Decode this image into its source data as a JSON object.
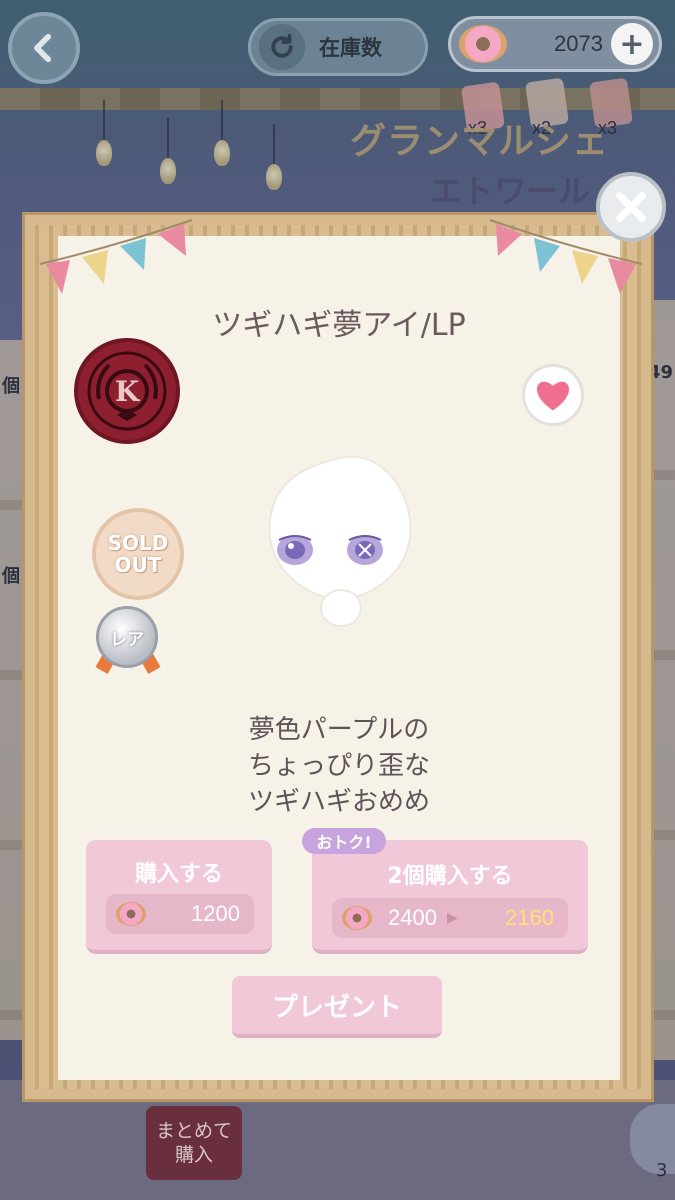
{
  "topbar": {
    "stock_label": "在庫数",
    "currency_value": "2073",
    "plus_label": "+"
  },
  "tickets": [
    {
      "count": "x3"
    },
    {
      "count": "x2"
    },
    {
      "count": "x3"
    }
  ],
  "event": {
    "title": "グランマルシェ",
    "subtitle": "エトワール"
  },
  "side_labels": {
    "left_count_1": "個",
    "left_count_2": "個",
    "right_count": "49",
    "corner_count": "3"
  },
  "item": {
    "title": "ツギハギ夢アイ/LP",
    "brand_letter": "K",
    "sold_out_line1": "SOLD",
    "sold_out_line2": "OUT",
    "rarity": "レア",
    "description_line1": "夢色パープルの",
    "description_line2": "ちょっぴり歪な",
    "description_line3": "ツギハギおめめ"
  },
  "buy_single": {
    "label": "購入する",
    "price": "1200"
  },
  "buy_double": {
    "deal_badge": "おトク!",
    "label": "2個購入する",
    "price_original": "2400",
    "price_sale": "2160"
  },
  "present": {
    "label": "プレゼント"
  },
  "bulk": {
    "line1": "まとめて",
    "line2": "購入"
  },
  "colors": {
    "button_pink": "#f0c8d8",
    "sale_price": "#ffe07a",
    "brand_badge": "#8e1f2f"
  }
}
